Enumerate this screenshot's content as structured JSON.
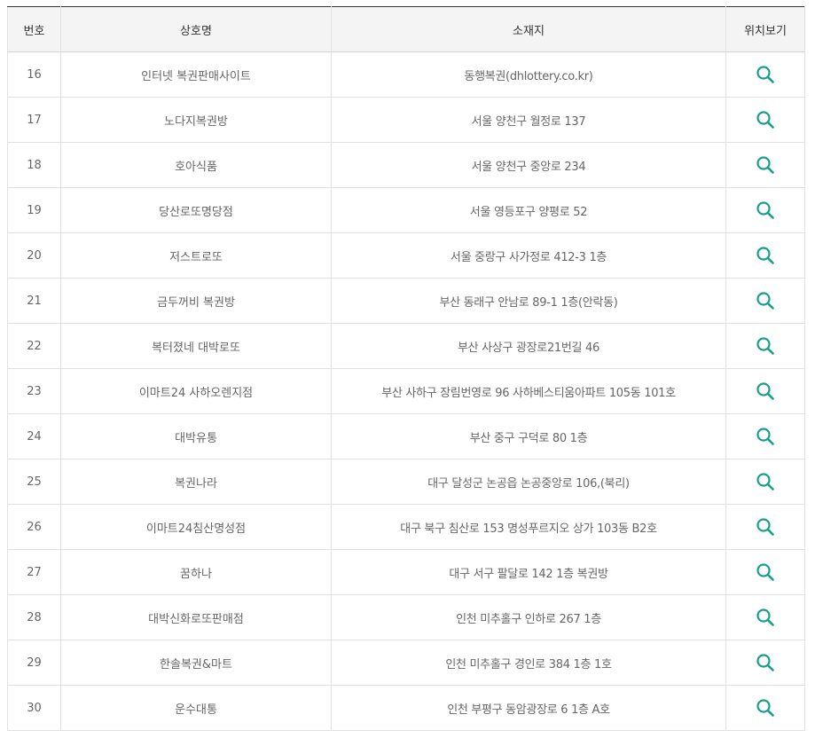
{
  "table": {
    "headers": {
      "no": "번호",
      "name": "상호명",
      "address": "소재지",
      "location": "위치보기"
    },
    "icon": "search-icon",
    "icon_color": "#1a9e8c",
    "rows": [
      {
        "no": "16",
        "name": "인터넷 복권판매사이트",
        "address": "동행복권(dhlottery.co.kr)"
      },
      {
        "no": "17",
        "name": "노다지복권방",
        "address": "서울 양천구 월정로 137"
      },
      {
        "no": "18",
        "name": "호아식품",
        "address": "서울 양천구 중앙로 234"
      },
      {
        "no": "19",
        "name": "당산로또명당점",
        "address": "서울 영등포구 양평로 52"
      },
      {
        "no": "20",
        "name": "저스트로또",
        "address": "서울 중랑구 사가정로 412-3 1층"
      },
      {
        "no": "21",
        "name": "금두꺼비 복권방",
        "address": "부산 동래구 안남로 89-1 1층(안락동)"
      },
      {
        "no": "22",
        "name": "복터졌네 대박로또",
        "address": "부산 사상구 광장로21번길 46"
      },
      {
        "no": "23",
        "name": "이마트24 사하오렌지점",
        "address": "부산 사하구 장림번영로 96 사하베스티움아파트 105동 101호"
      },
      {
        "no": "24",
        "name": "대박유통",
        "address": "부산 중구 구덕로 80 1층"
      },
      {
        "no": "25",
        "name": "복권나라",
        "address": "대구 달성군 논공읍 논공중앙로 106,(북리)"
      },
      {
        "no": "26",
        "name": "이마트24침산명성점",
        "address": "대구 북구 침산로 153 명성푸르지오 상가 103동 B2호"
      },
      {
        "no": "27",
        "name": "꿈하나",
        "address": "대구 서구 팔달로 142 1층 복권방"
      },
      {
        "no": "28",
        "name": "대박신화로또판매점",
        "address": "인천 미추홀구 인하로 267 1층"
      },
      {
        "no": "29",
        "name": "한솔복권&마트",
        "address": "인천 미추홀구 경인로 384 1층 1호"
      },
      {
        "no": "30",
        "name": "운수대통",
        "address": "인천 부평구 동암광장로 6 1층 A호"
      }
    ]
  }
}
